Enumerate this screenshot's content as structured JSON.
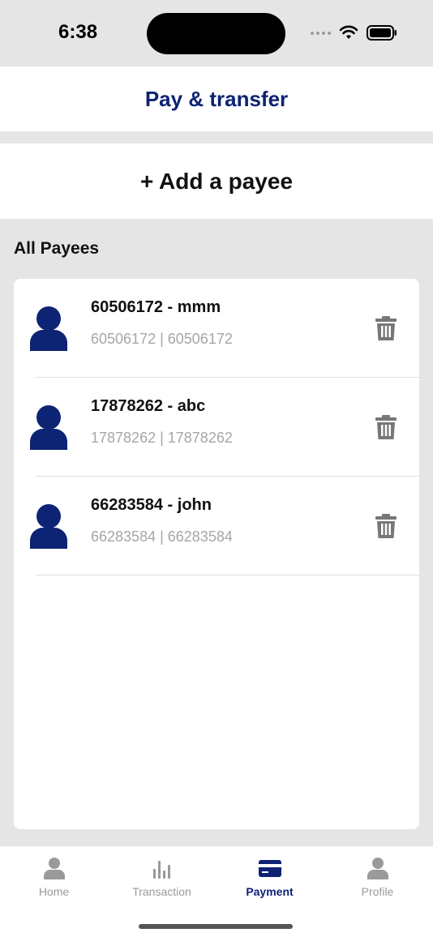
{
  "status_bar": {
    "time": "6:38"
  },
  "header": {
    "title": "Pay & transfer"
  },
  "add_payee": {
    "label": "+ Add a payee"
  },
  "payees_section": {
    "title": "All Payees",
    "items": [
      {
        "name": "60506172 - mmm",
        "detail": "60506172 | 60506172"
      },
      {
        "name": "17878262 - abc",
        "detail": "17878262 | 17878262"
      },
      {
        "name": "66283584 - john",
        "detail": "66283584 | 66283584"
      }
    ]
  },
  "tabs": [
    {
      "label": "Home",
      "icon": "person-icon",
      "active": false
    },
    {
      "label": "Transaction",
      "icon": "bar-chart-icon",
      "active": false
    },
    {
      "label": "Payment",
      "icon": "card-icon",
      "active": true
    },
    {
      "label": "Profile",
      "icon": "person-icon",
      "active": false
    }
  ],
  "colors": {
    "brand": "#0d2373",
    "muted": "#a6a6a6",
    "background": "#e5e5e5"
  }
}
